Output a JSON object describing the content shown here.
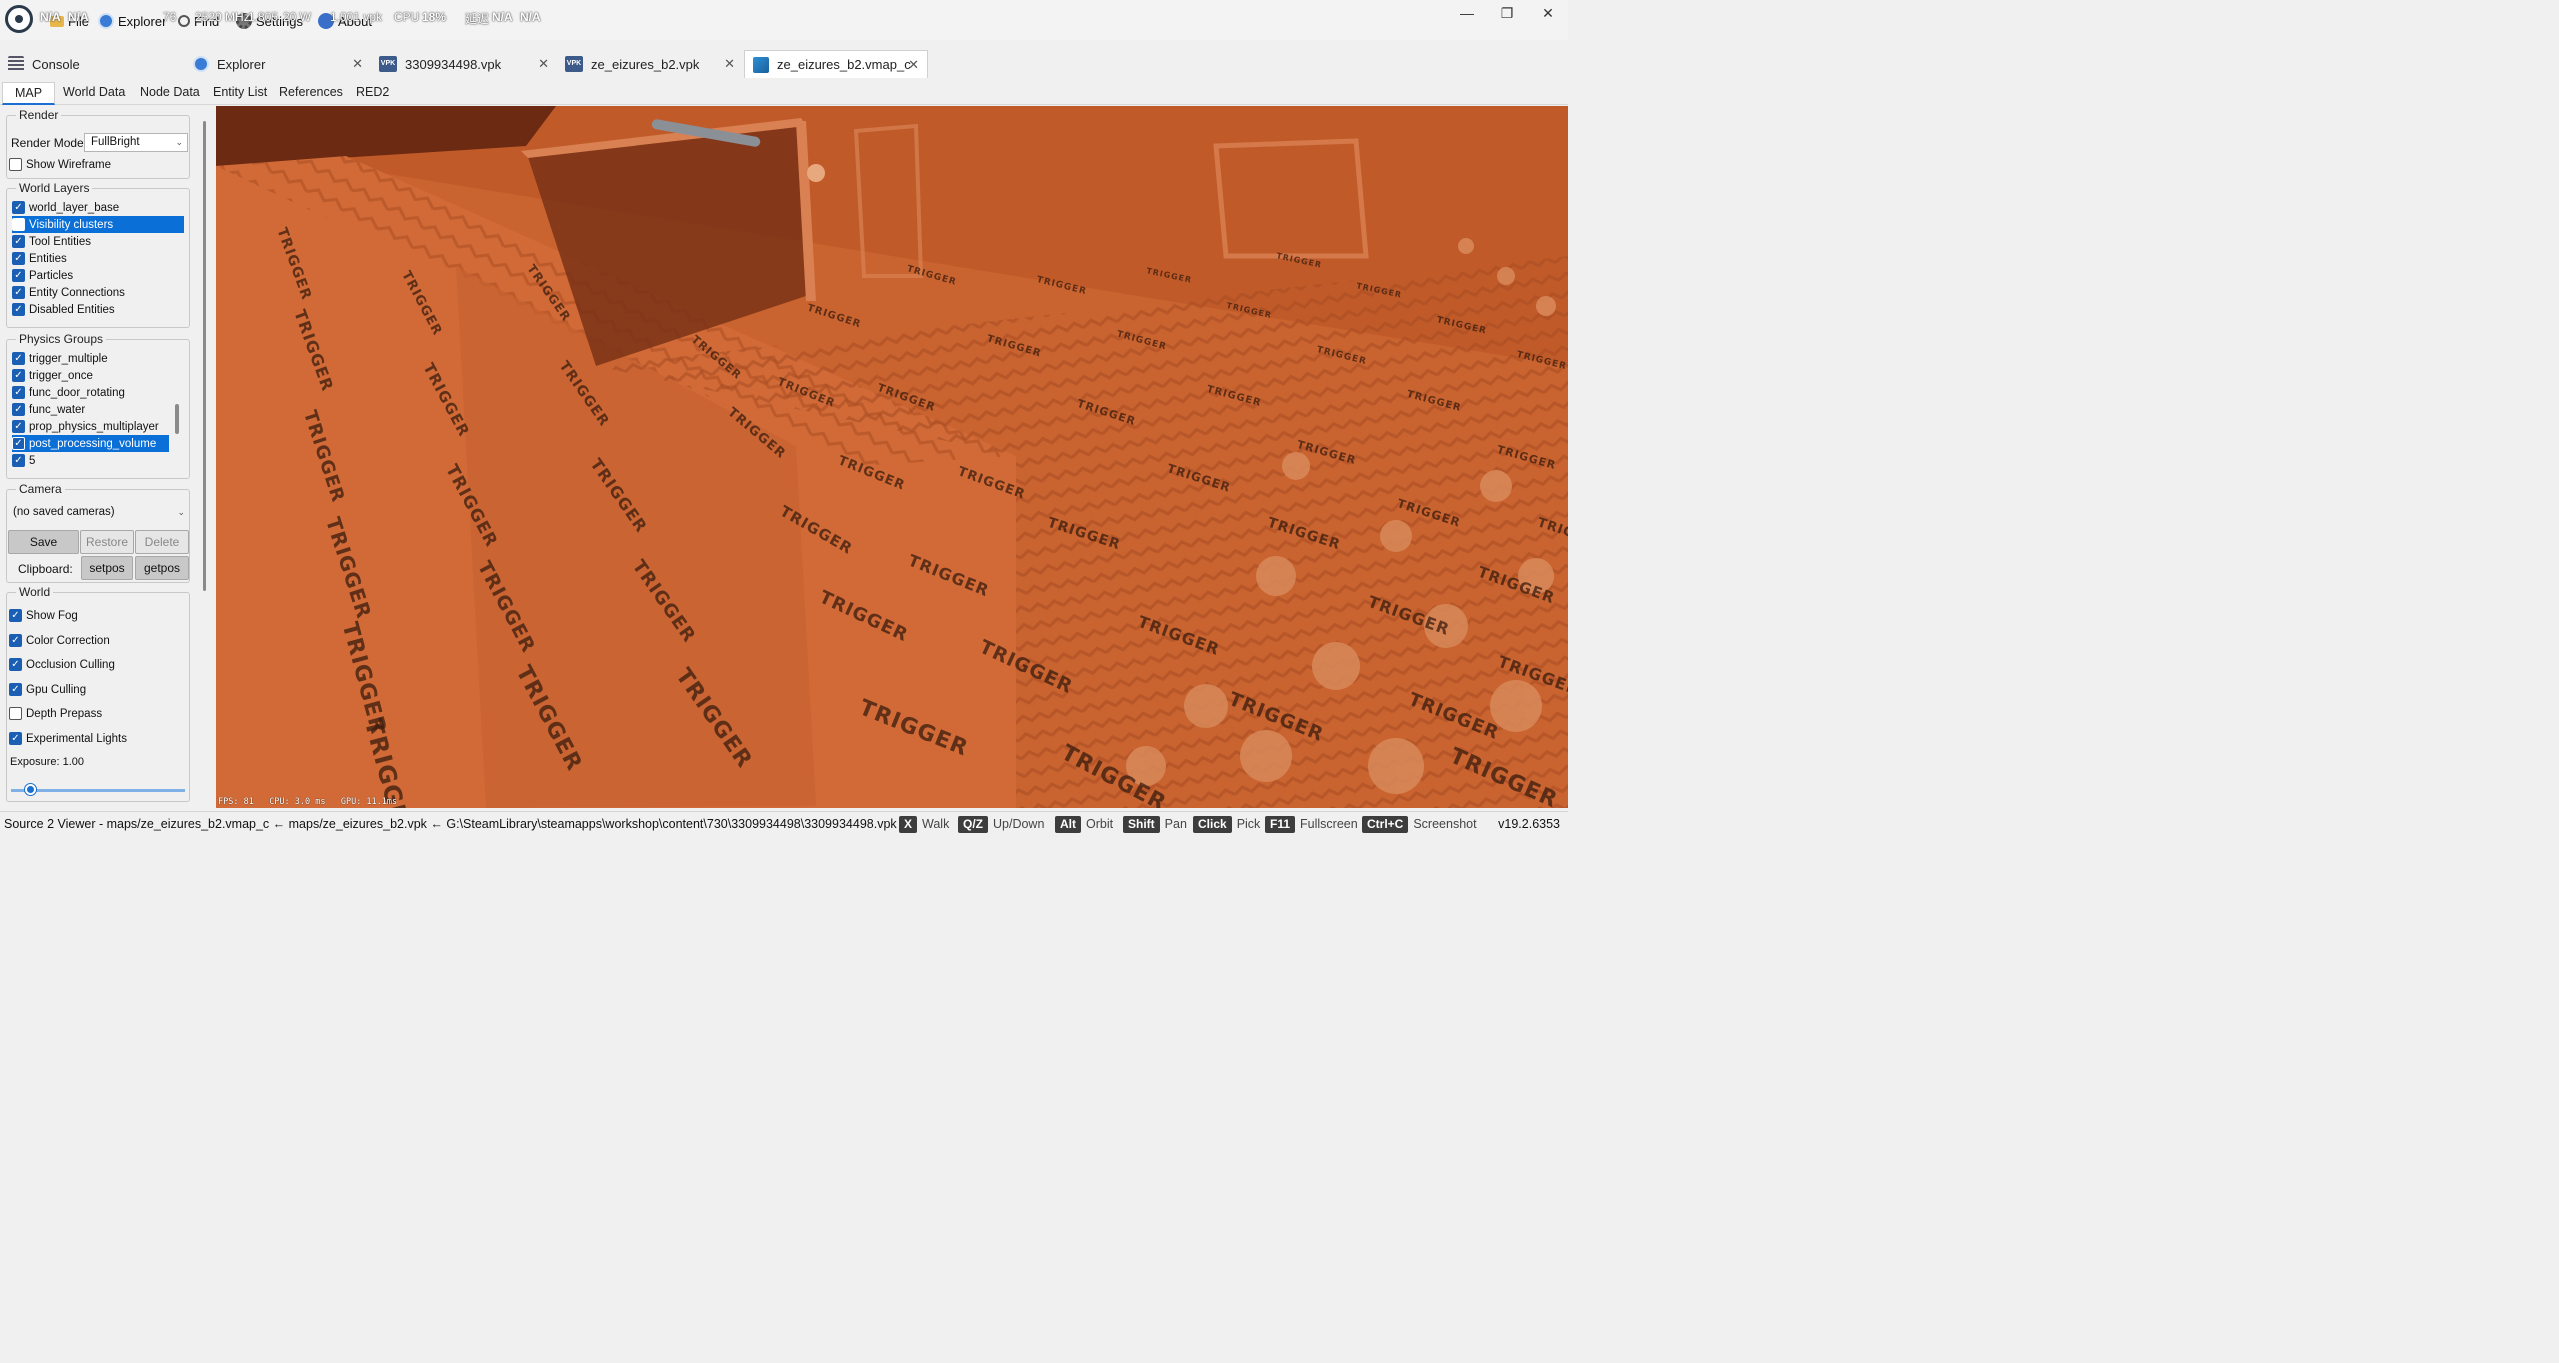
{
  "menubar": {
    "items": [
      "File",
      "Explorer",
      "Find",
      "Settings",
      "About"
    ],
    "overlay": {
      "left_values": [
        "N/A",
        "N/A",
        "76",
        "2520 MHz",
        "1.805",
        "20 W",
        "1.001 vpk"
      ],
      "cpu_label": "CPU",
      "cpu_value": "18%",
      "ping_label": "延迟",
      "ping_a": "N/A",
      "ping_b": "N/A"
    },
    "window_controls": [
      "—",
      "❐",
      "✕"
    ]
  },
  "tabs": [
    {
      "label": "Console",
      "icon": "console-icon",
      "closable": false
    },
    {
      "label": "Explorer",
      "icon": "compass-icon",
      "closable": true
    },
    {
      "label": "3309934498.vpk",
      "icon": "vpk-icon",
      "icon_text": "VPK",
      "closable": true
    },
    {
      "label": "ze_eizures_b2.vpk",
      "icon": "vpk-icon",
      "icon_text": "VPK",
      "closable": true
    },
    {
      "label": "ze_eizures_b2.vmap_c",
      "icon": "map-icon",
      "closable": true,
      "active": true
    }
  ],
  "close_glyph": "✕",
  "subtabs": [
    "MAP",
    "World Data",
    "Node Data",
    "Entity List",
    "References",
    "RED2"
  ],
  "render": {
    "title": "Render",
    "mode_label": "Render Mode",
    "mode_value": "FullBright",
    "wireframe_label": "Show Wireframe",
    "wireframe_checked": false
  },
  "world_layers": {
    "title": "World Layers",
    "items": [
      {
        "label": "world_layer_base",
        "checked": true
      },
      {
        "label": "Visibility clusters",
        "checked": false,
        "selected": true
      },
      {
        "label": "Tool Entities",
        "checked": true
      },
      {
        "label": "Entities",
        "checked": true
      },
      {
        "label": "Particles",
        "checked": true
      },
      {
        "label": "Entity Connections",
        "checked": true
      },
      {
        "label": "Disabled Entities",
        "checked": true
      }
    ]
  },
  "physics_groups": {
    "title": "Physics Groups",
    "items": [
      {
        "label": "trigger_multiple",
        "checked": true
      },
      {
        "label": "trigger_once",
        "checked": true
      },
      {
        "label": "func_door_rotating",
        "checked": true
      },
      {
        "label": "func_water",
        "checked": true
      },
      {
        "label": "prop_physics_multiplayer",
        "checked": true
      },
      {
        "label": "post_processing_volume",
        "checked": true,
        "selected": true
      },
      {
        "label": "5",
        "checked": true
      }
    ]
  },
  "camera": {
    "title": "Camera",
    "saved_value": "(no saved cameras)",
    "save": "Save",
    "restore": "Restore",
    "delete": "Delete",
    "clipboard_label": "Clipboard:",
    "setpos": "setpos",
    "getpos": "getpos"
  },
  "world": {
    "title": "World",
    "items": [
      {
        "label": "Show Fog",
        "checked": true
      },
      {
        "label": "Color Correction",
        "checked": true
      },
      {
        "label": "Occlusion Culling",
        "checked": true
      },
      {
        "label": "Gpu Culling",
        "checked": true
      },
      {
        "label": "Depth Prepass",
        "checked": false
      },
      {
        "label": "Experimental Lights",
        "checked": true
      }
    ],
    "exposure_label": "Exposure: 1.00",
    "exposure_value": 1.0
  },
  "viewport": {
    "trigger_text": "TRIGGER",
    "stats": {
      "fps": "FPS: 81",
      "cpu": "CPU: 3.0 ms",
      "gpu": "GPU: 11.1ms"
    }
  },
  "statusbar": {
    "path": "Source 2 Viewer - maps/ze_eizures_b2.vmap_c ← maps/ze_eizures_b2.vpk ← G:\\SteamLibrary\\steamapps\\workshop\\content\\730\\3309934498\\3309934498.vpk",
    "hints": [
      {
        "key": "X",
        "action": "Walk"
      },
      {
        "key": "Q/Z",
        "action": "Up/Down"
      },
      {
        "key": "Alt",
        "action": "Orbit"
      },
      {
        "key": "Shift",
        "action": "Pan"
      },
      {
        "key": "Click",
        "action": "Pick"
      },
      {
        "key": "F11",
        "action": "Fullscreen"
      },
      {
        "key": "Ctrl+C",
        "action": "Screenshot"
      }
    ],
    "version": "v19.2.6353"
  },
  "colors": {
    "accent": "#0a6fd6",
    "viewport_orange": "#c8612f",
    "trigger_text": "#3a1c0e",
    "key_bg": "#3d3d3d"
  }
}
